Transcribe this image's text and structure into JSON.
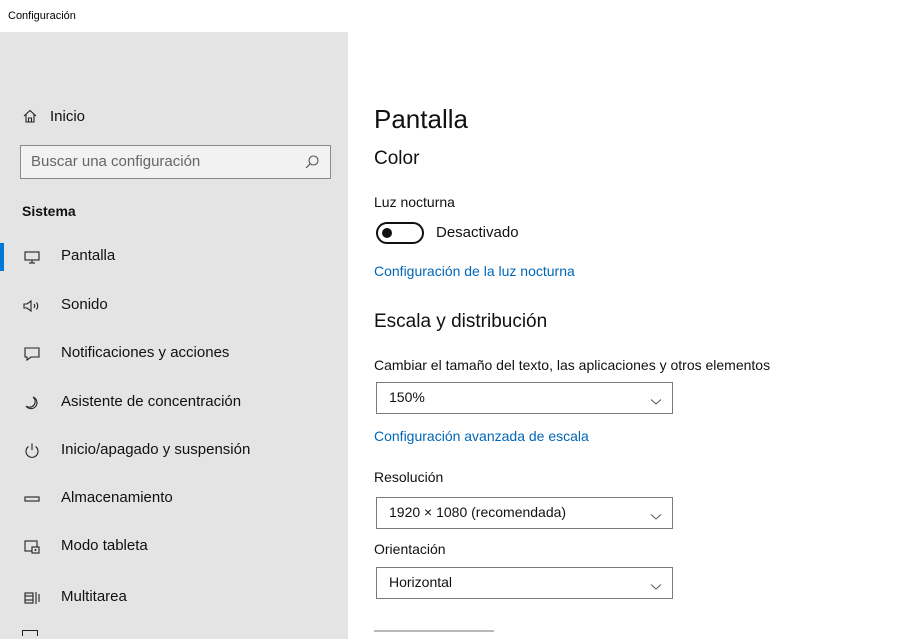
{
  "window": {
    "title": "Configuración",
    "minimize_icon": "minimize-icon",
    "maximize_icon": "maximize-icon",
    "close_icon": "close-icon"
  },
  "colors": {
    "sidebar_bg": "#e4e4e4",
    "accent": "#0078d7",
    "link": "#0067b8"
  },
  "sidebar": {
    "home_label": "Inicio",
    "search_placeholder": "Buscar una configuración",
    "section_title": "Sistema",
    "items": [
      {
        "label": "Pantalla",
        "icon": "monitor-icon",
        "active": true
      },
      {
        "label": "Sonido",
        "icon": "speaker-icon",
        "active": false
      },
      {
        "label": "Notificaciones y acciones",
        "icon": "notification-icon",
        "active": false
      },
      {
        "label": "Asistente de concentración",
        "icon": "moon-icon",
        "active": false
      },
      {
        "label": "Inicio/apagado y suspensión",
        "icon": "power-icon",
        "active": false
      },
      {
        "label": "Almacenamiento",
        "icon": "storage-icon",
        "active": false
      },
      {
        "label": "Modo tableta",
        "icon": "tablet-icon",
        "active": false
      },
      {
        "label": "Multitarea",
        "icon": "multitask-icon",
        "active": false
      }
    ]
  },
  "main": {
    "page_title": "Pantalla",
    "color_heading": "Color",
    "night_light_label": "Luz nocturna",
    "night_light_state": "Desactivado",
    "night_light_on": false,
    "night_light_link": "Configuración de la luz nocturna",
    "scale_heading": "Escala y distribución",
    "scale_label": "Cambiar el tamaño del texto, las aplicaciones y otros elementos",
    "scale_value": "150%",
    "advanced_scale_link": "Configuración avanzada de escala",
    "resolution_label": "Resolución",
    "resolution_value": "1920 × 1080 (recomendada)",
    "orientation_label": "Orientación",
    "orientation_value": "Horizontal"
  }
}
